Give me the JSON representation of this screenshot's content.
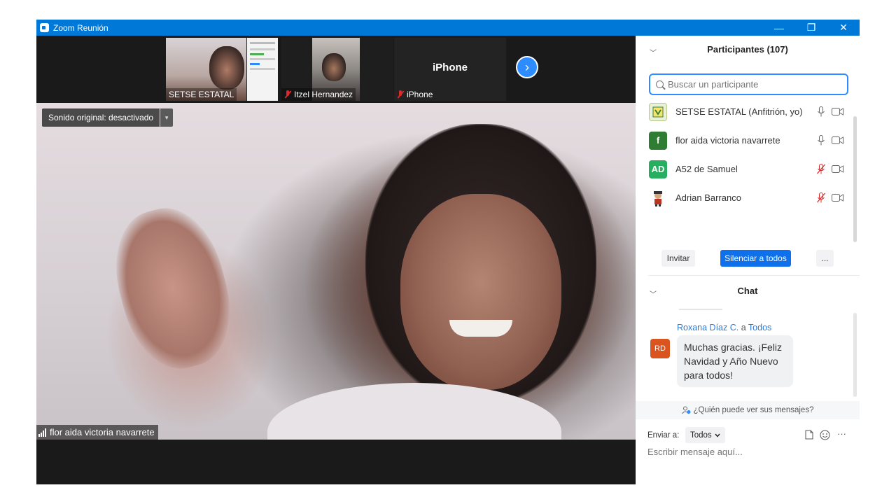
{
  "window": {
    "title": "Zoom Reunión",
    "controls": {
      "minimize": "—",
      "restore": "❐",
      "close": "✕"
    }
  },
  "thumbnails": [
    {
      "label": "SETSE ESTATAL",
      "muted": false
    },
    {
      "label": "Itzel Hernandez",
      "muted": true
    },
    {
      "label": "iPhone",
      "name_display": "iPhone",
      "muted": true
    }
  ],
  "next_glyph": "›",
  "main_video": {
    "original_sound": "Sonido original: desactivado",
    "original_sound_caret": "▾",
    "speaker": "flor aida victoria navarrete"
  },
  "participants": {
    "title": "Participantes (107)",
    "search_placeholder": "Buscar un participante",
    "items": [
      {
        "name": "SETSE ESTATAL (Anfitrión, yo)",
        "initials": "",
        "avatar": "logo",
        "mic": "on"
      },
      {
        "name": "flor aida victoria navarrete",
        "initials": "f",
        "avatar_color": "#2e7d32",
        "mic": "on"
      },
      {
        "name": "A52 de Samuel",
        "initials": "AD",
        "avatar_color": "#27ae60",
        "mic": "off"
      },
      {
        "name": "Adrian Barranco",
        "initials": "",
        "avatar": "picture",
        "mic": "off"
      }
    ],
    "invite": "Invitar",
    "mute_all": "Silenciar a todos",
    "more": "..."
  },
  "chat": {
    "title": "Chat",
    "message": {
      "sender": "Roxana Díaz C.",
      "to_word": "a",
      "recipient": "Todos",
      "initials": "RD",
      "text": "Muchas gracias. ¡Feliz Navidad y Año Nuevo para todos!"
    },
    "who_can_see": "¿Quién puede ver sus mensajes?",
    "send_to_label": "Enviar a:",
    "send_to_value": "Todos",
    "more_glyph": "···",
    "input_placeholder": "Escribir mensaje aquí..."
  },
  "colors": {
    "titlebar": "#0078d7",
    "accent": "#2d8cff",
    "muted": "#e02828",
    "button_blue": "#0e71eb"
  }
}
